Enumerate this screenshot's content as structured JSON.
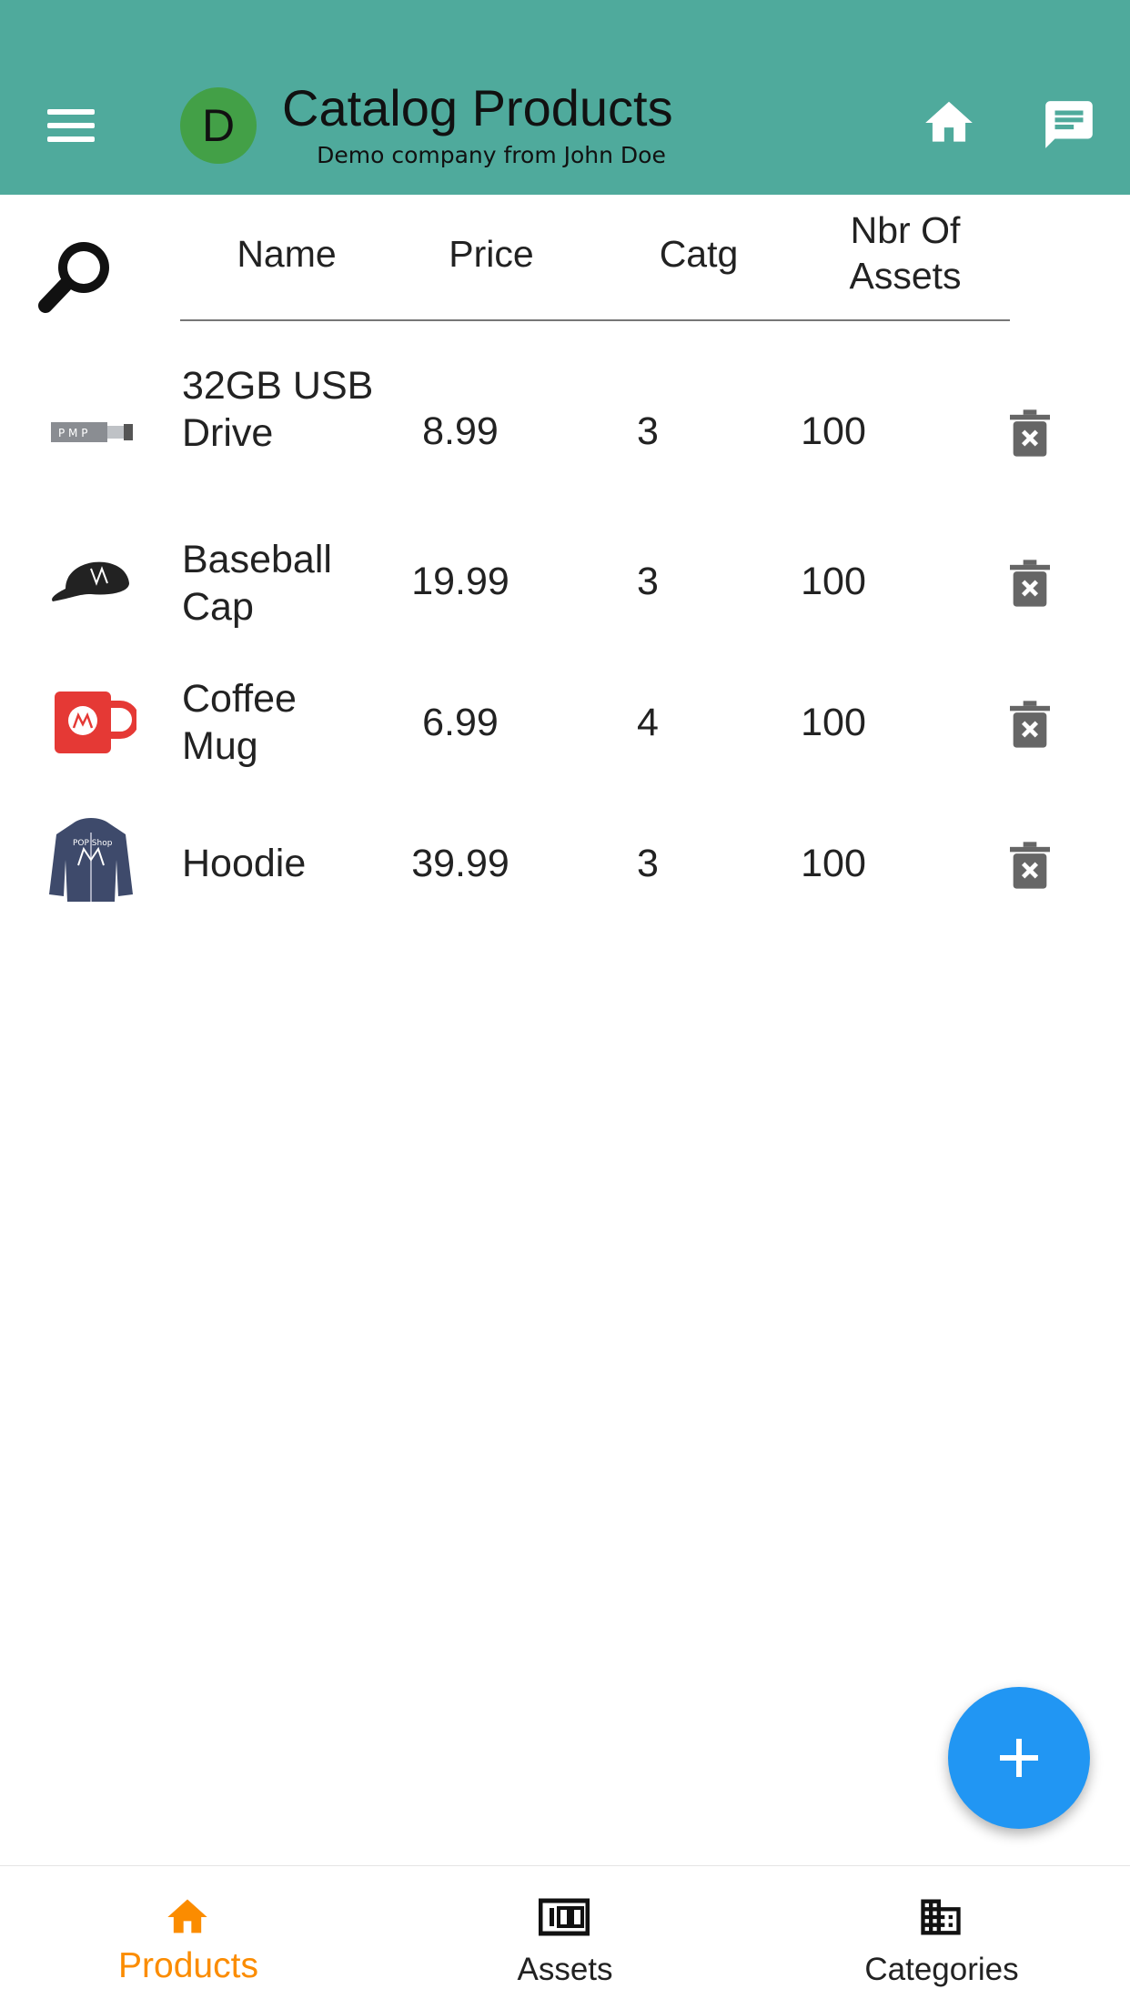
{
  "appbar": {
    "title": "Catalog Products",
    "subtitle": "Demo company from John Doe",
    "avatar_letter": "D",
    "bg_color": "#4faa9c",
    "icons": [
      "menu-icon",
      "home-icon",
      "chat-icon"
    ]
  },
  "table": {
    "columns": [
      "Name",
      "Price",
      "Catg",
      "Nbr Of Assets"
    ],
    "rows": [
      {
        "name": "32GB USB Drive",
        "price": "8.99",
        "catg": "3",
        "assets": "100",
        "thumbnail": "usb-drive-image"
      },
      {
        "name": "Baseball Cap",
        "price": "19.99",
        "catg": "3",
        "assets": "100",
        "thumbnail": "baseball-cap-image"
      },
      {
        "name": "Coffee Mug",
        "price": "6.99",
        "catg": "4",
        "assets": "100",
        "thumbnail": "coffee-mug-image"
      },
      {
        "name": "Hoodie",
        "price": "39.99",
        "catg": "3",
        "assets": "100",
        "thumbnail": "hoodie-image"
      }
    ]
  },
  "fab": {
    "icon": "plus-icon",
    "color": "#2196f3"
  },
  "bottom_nav": {
    "items": [
      {
        "label": "Products",
        "icon": "home-icon",
        "active": true
      },
      {
        "label": "Assets",
        "icon": "counter-icon",
        "active": false
      },
      {
        "label": "Categories",
        "icon": "building-icon",
        "active": false
      }
    ],
    "active_color": "#fb8c00"
  }
}
